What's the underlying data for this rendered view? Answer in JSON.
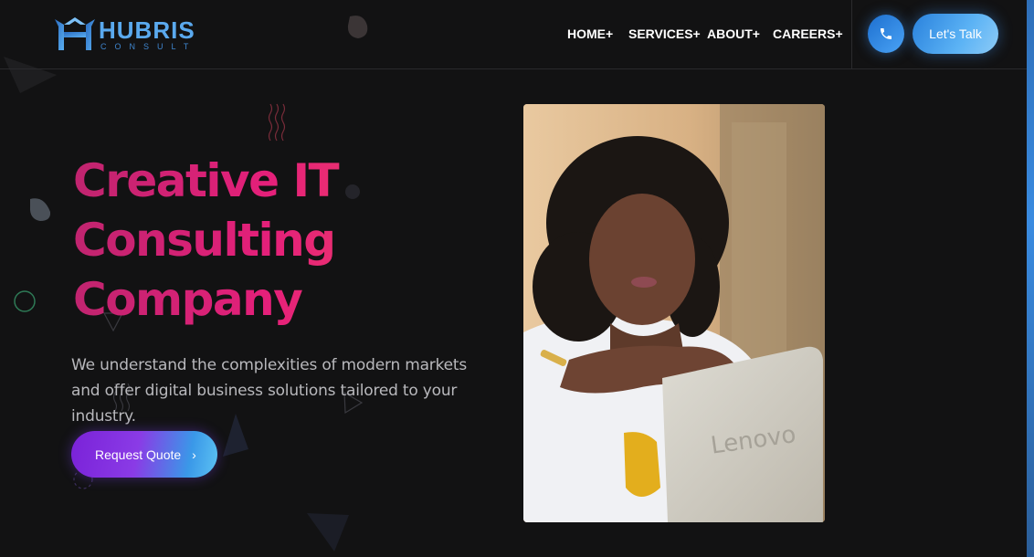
{
  "brand": {
    "name": "HUBRIS",
    "sub": "CONSULT"
  },
  "nav": {
    "items": [
      {
        "label": "HOME+"
      },
      {
        "label": "SERVICES+"
      },
      {
        "label": "ABOUT+"
      },
      {
        "label": "CAREERS+"
      }
    ]
  },
  "header": {
    "cta_label": "Let's Talk",
    "phone_icon": "phone-icon"
  },
  "hero": {
    "title_lines": [
      "Creative IT",
      "Consulting",
      "Company"
    ],
    "description": "We understand the complexities of modern markets and offer digital business solutions tailored to your industry.",
    "button_label": "Request Quote",
    "button_icon": "chevron-right-icon"
  },
  "photo": {
    "laptop_brand": "Lenovo"
  },
  "colors": {
    "background": "#121213",
    "accent_pink": "#e5207a",
    "accent_blue": "#3a8be0",
    "accent_purple": "#7a22d8"
  }
}
